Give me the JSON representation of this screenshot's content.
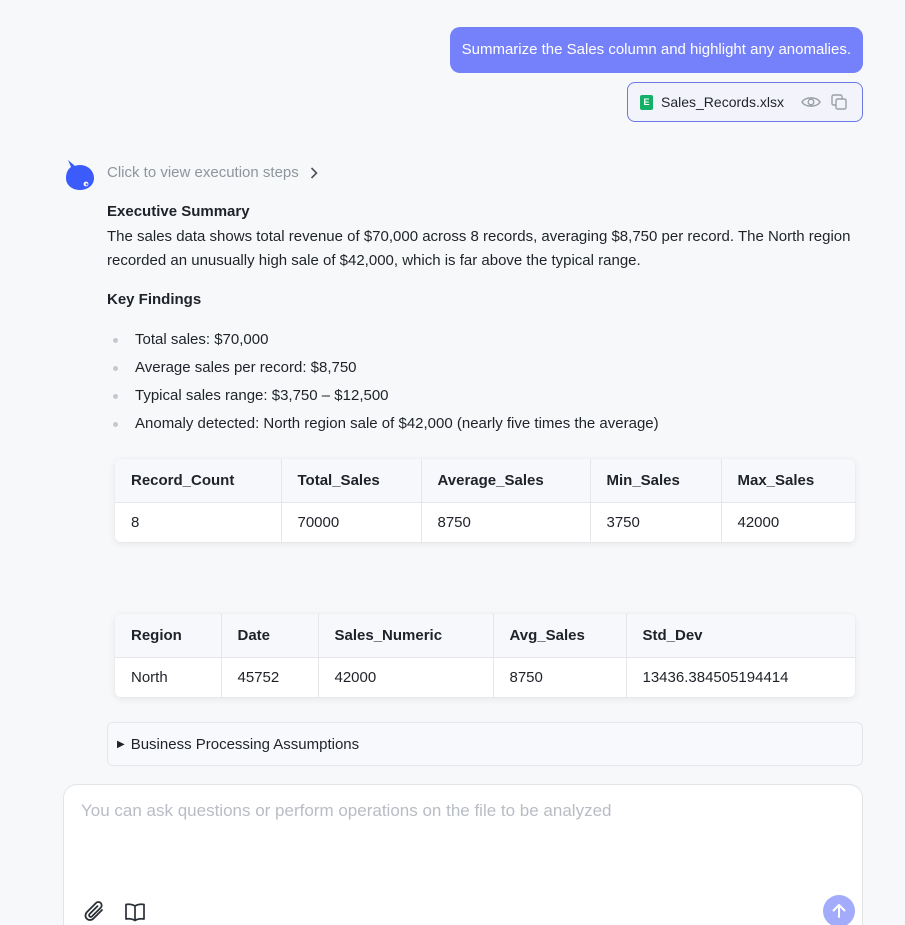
{
  "user_message": {
    "text": "Summarize the Sales column and highlight any anomalies.",
    "attachment": {
      "file_name": "Sales_Records.xlsx",
      "file_icon_letter": "E",
      "icons": [
        "eye-icon",
        "copy-icon"
      ]
    }
  },
  "assistant": {
    "execution_steps_label": "Click to view execution steps",
    "executive_summary": {
      "title": "Executive Summary",
      "text": "The sales data shows total revenue of $70,000 across 8 records, averaging $8,750 per record. The North region recorded an unusually high sale of $42,000, which is far above the typical range."
    },
    "key_findings": {
      "title": "Key Findings",
      "items": [
        "Total sales: $70,000",
        "Average sales per record: $8,750",
        "Typical sales range: $3,750 – $12,500",
        "Anomaly detected: North region sale of $42,000 (nearly five times the average)"
      ]
    },
    "summary_table": {
      "headers": [
        "Record_Count",
        "Total_Sales",
        "Average_Sales",
        "Min_Sales",
        "Max_Sales"
      ],
      "rows": [
        [
          "8",
          "70000",
          "8750",
          "3750",
          "42000"
        ]
      ]
    },
    "anomaly_table": {
      "headers": [
        "Region",
        "Date",
        "Sales_Numeric",
        "Avg_Sales",
        "Std_Dev"
      ],
      "rows": [
        [
          "North",
          "45752",
          "42000",
          "8750",
          "13436.384505194414"
        ]
      ]
    },
    "assumptions_label": "Business Processing Assumptions"
  },
  "input": {
    "placeholder": "You can ask questions or perform operations on the file to be analyzed",
    "value": ""
  },
  "colors": {
    "accent": "#7580fb",
    "send_button": "#a3acfb",
    "excel_green": "#15b068"
  }
}
